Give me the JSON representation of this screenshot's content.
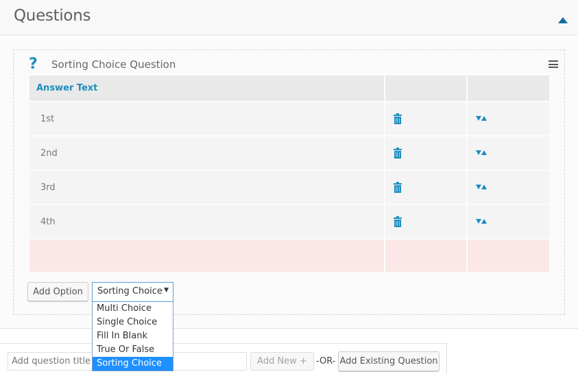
{
  "header": {
    "title": "Questions",
    "collapse_icon": "triangle-up-icon"
  },
  "question": {
    "icon": "question-mark-icon",
    "title": "Sorting Choice Question",
    "menu_icon": "hamburger-menu-icon",
    "table": {
      "columns": [
        "Answer Text",
        "",
        ""
      ],
      "rows": [
        {
          "answer": "1st",
          "delete_icon": "trash-icon",
          "sort_icon": "sort-arrows-icon"
        },
        {
          "answer": "2nd",
          "delete_icon": "trash-icon",
          "sort_icon": "sort-arrows-icon"
        },
        {
          "answer": "3rd",
          "delete_icon": "trash-icon",
          "sort_icon": "sort-arrows-icon"
        },
        {
          "answer": "4th",
          "delete_icon": "trash-icon",
          "sort_icon": "sort-arrows-icon"
        }
      ]
    },
    "add_option_label": "Add Option",
    "type_select": {
      "selected": "Sorting Choice",
      "options": [
        "Multi Choice",
        "Single Choice",
        "Fill In Blank",
        "True Or False",
        "Sorting Choice"
      ],
      "highlighted_index": 4
    }
  },
  "add_bar": {
    "title_placeholder": "Add question title and press Enter",
    "add_new_label": "Add New  +",
    "or_label": "-OR-",
    "add_existing_label": "Add Existing Question"
  },
  "colors": {
    "accent": "#1e8cbe",
    "collapse_arrow": "#0f6da6",
    "dropdown_highlight": "#1e90ff",
    "empty_row": "#fbe7e7"
  }
}
